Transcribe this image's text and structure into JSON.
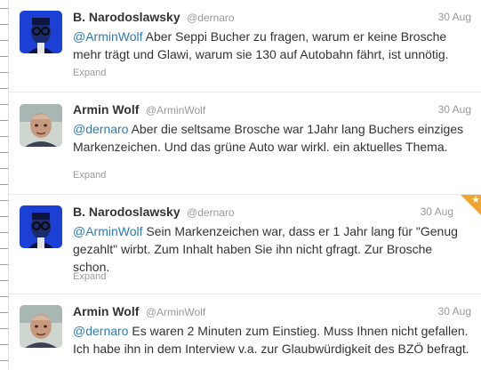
{
  "tweets": [
    {
      "name": "B. Narodoslawsky",
      "handle": "@dernaro",
      "date": "30 Aug",
      "mention": "@ArminWolf",
      "text": " Aber Seppi Bucher zu fragen, warum er keine Brosche mehr trägt und Glawi, warum sie 130 auf Autobahn fährt, ist unnötig.",
      "expand": "Expand",
      "avatar": "glasses-man-blue-avatar"
    },
    {
      "name": "Armin Wolf",
      "handle": "@ArminWolf",
      "date": "30 Aug",
      "mention": "@dernaro",
      "text": " Aber die seltsame Brosche war 1Jahr lang Buchers einziges Markenzeichen. Und das grüne Auto war wirkl. ein aktuelles Thema.",
      "expand": "Expand",
      "avatar": "bald-man-photo-avatar"
    },
    {
      "name": "B. Narodoslawsky",
      "handle": "@dernaro",
      "date": "30 Aug",
      "mention": "@ArminWolf",
      "text": " Sein Markenzeichen war, dass er 1 Jahr lang für \"Genug gezahlt\" wirbt. Zum Inhalt haben Sie ihn nicht gfragt. Zur Brosche schon.",
      "expand": "Expand",
      "avatar": "glasses-man-blue-avatar",
      "favorited": true
    },
    {
      "name": "Armin Wolf",
      "handle": "@ArminWolf",
      "date": "30 Aug",
      "mention": "@dernaro",
      "text": " Es waren 2 Minuten zum Einstieg. Muss Ihnen nicht gefallen. Ich habe ihn in dem Interview v.a. zur Glaubwürdigkeit des BZÖ befragt.",
      "avatar": "bald-man-photo-avatar"
    }
  ],
  "colors": {
    "link": "#2f7ab6",
    "favorite_corner": "#f0a531"
  }
}
